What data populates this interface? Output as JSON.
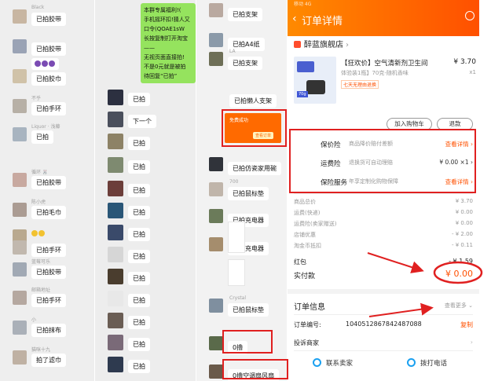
{
  "col1": {
    "rows": [
      {
        "nick": "Black",
        "text": "已拍胶带",
        "avatar": "#c8b6a2"
      },
      {
        "nick": "",
        "text": "已拍胶带",
        "avatar": "#9aa3b5"
      },
      {
        "nick": "",
        "text": "已拍胶巾",
        "avatar": "#d0c2a8",
        "emoji": 3
      },
      {
        "nick": "不乎",
        "text": "已拍手环",
        "avatar": "#b7b0a6"
      },
      {
        "nick": "Liquor · 浅藤",
        "text": "已拍",
        "avatar": "#a8b4c0"
      },
      {
        "nick": "循环 🐰",
        "text": "已拍胶带",
        "avatar": "#c8a9a0"
      },
      {
        "nick": "陈小虎",
        "text": "已拍毛巾",
        "avatar": "#ab9c93"
      },
      {
        "nick": "",
        "text": "",
        "avatar": "#b9a98f",
        "yemoji": 2
      },
      {
        "nick": "",
        "text": "已拍手环",
        "avatar": "#c1b8ae"
      },
      {
        "nick": "蓝莓可乐",
        "text": "已拍胶带",
        "avatar": "#a1a9b4"
      },
      {
        "nick": "邮箱地址",
        "text": "已拍手环",
        "avatar": "#b5a8a0"
      },
      {
        "nick": "小",
        "text": "已拍抹布",
        "avatar": "#aab0b8"
      },
      {
        "nick": "猫咪十九",
        "text": "拍了滤巾",
        "avatar": "#bfb1a3"
      }
    ]
  },
  "col2": {
    "green_lines": [
      "本群专属福利!(",
      "手机摇环扣!猜人又",
      "口令(QOAE1sW",
      "长按复制打开淘宝",
      "—— ",
      "无视页面直接拍!",
      "不是0元就是被拍",
      "待回复“已拍”"
    ],
    "rows": [
      {
        "text": "已拍",
        "avatar": "#2c3040"
      },
      {
        "text": "下一个",
        "avatar": "#4a4f5c"
      },
      {
        "text": "已拍",
        "avatar": "#8d8266"
      },
      {
        "text": "已拍",
        "avatar": "#7e8a70"
      },
      {
        "text": "已拍",
        "avatar": "#6c3e3a"
      },
      {
        "text": "已拍",
        "avatar": "#2a5677"
      },
      {
        "text": "已拍",
        "avatar": "#3a4a6a"
      },
      {
        "text": "已拍",
        "avatar": "#d6d6d6"
      },
      {
        "text": "已拍",
        "avatar": "#4a3d2e"
      },
      {
        "text": "已拍",
        "avatar": "#e8e8e8"
      },
      {
        "text": "已拍",
        "avatar": "#6a5d54"
      },
      {
        "text": "已拍",
        "avatar": "#7a6a78"
      },
      {
        "text": "已拍",
        "avatar": "#2e3a4f"
      }
    ]
  },
  "col3": {
    "rows": [
      {
        "nick": "",
        "text": "已拍支架",
        "avatar": "#b9a9a0"
      },
      {
        "nick": "",
        "text": "已拍A4纸",
        "avatar": "#8b9aa9"
      },
      {
        "nick": "LA",
        "text": "已拍支架",
        "avatar": "#6e6f57"
      },
      {
        "nick": "",
        "text": "已拍懒人支架",
        "avatar": ""
      },
      {
        "nick": "",
        "text": "",
        "avatar": ""
      },
      {
        "nick": "",
        "text": "已拍仿瓷家用碗",
        "avatar": "#30333a"
      },
      {
        "nick": "700",
        "text": "已拍鼠标垫",
        "avatar": "#c0b5aa"
      },
      {
        "nick": "",
        "text": "已拍充电器",
        "avatar": "#6b7b5a"
      },
      {
        "nick": "",
        "text": "已拍充电器",
        "avatar": "#a58d6d"
      },
      {
        "nick": "Crystal",
        "text": "已拍鼠标垫",
        "avatar": "#7f8f9f"
      },
      {
        "nick": "",
        "text": "0撸",
        "avatar": "#5a6a4a"
      },
      {
        "nick": "",
        "text": "0撸空调扇风扇",
        "avatar": "#6a5a4a"
      }
    ],
    "mini_card": {
      "title": "免费成功",
      "btn": "查看订单"
    }
  },
  "order": {
    "status_bar": "移动 4G",
    "title": "订单详情",
    "shop_name": "醉蓝旗舰店",
    "product_title": "【狂欢价】空气清新剂卫生间",
    "product_price": "¥ 3.70",
    "product_spec": "体验装1瓶】70克-随机香味",
    "product_qty": "x1",
    "product_tag": "七天无理由退换",
    "product_img_label": "70g",
    "btn_cart": "加入购物车",
    "btn_refund": "退款",
    "services": [
      {
        "k": "保价险",
        "v": "商品降价赔付差额",
        "r": "查看详情 ›",
        "orange": true
      },
      {
        "k": "运费险",
        "v": "退换货可自动理赔",
        "r": "¥ 0.00 ×1 ›",
        "orange": false
      },
      {
        "k": "保险服务",
        "v": "年享定制化购物保障",
        "r": "查看详情 ›",
        "orange": true
      }
    ],
    "fees": [
      {
        "k": "商品总价",
        "v": "¥ 3.70"
      },
      {
        "k": "运费(快递)",
        "v": "¥ 0.00"
      },
      {
        "k": "运费险(卖家赠送)",
        "v": "¥ 0.00"
      },
      {
        "k": "店铺优惠",
        "v": "- ¥ 2.00"
      },
      {
        "k": "淘金币抵扣",
        "v": "- ¥ 0.11"
      }
    ],
    "red_packet": "红包",
    "red_packet_value": "- ¥ 1.59",
    "paid_label": "实付款",
    "paid_value": "¥ 0.00",
    "info_header": "订单信息",
    "info_more": "查看更多 ⌄",
    "order_no_label": "订单编号:",
    "order_no": "1040512867842487088",
    "copy": "复制",
    "complain": "投诉商家",
    "contact": "联系卖家",
    "call": "拨打电话",
    "colors": {
      "accent": "#ff5000",
      "gradient_start": "#ff8a00",
      "red_box": "#e02020"
    }
  }
}
